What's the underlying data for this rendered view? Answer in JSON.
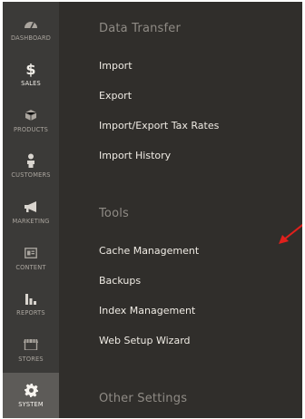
{
  "sidebar": {
    "items": [
      {
        "label": "DASHBOARD",
        "icon": "dashboard-gauge-icon"
      },
      {
        "label": "SALES",
        "icon": "dollar-icon",
        "glyph": "$"
      },
      {
        "label": "PRODUCTS",
        "icon": "cube-icon"
      },
      {
        "label": "CUSTOMERS",
        "icon": "person-icon"
      },
      {
        "label": "MARKETING",
        "icon": "megaphone-icon"
      },
      {
        "label": "CONTENT",
        "icon": "layout-icon"
      },
      {
        "label": "REPORTS",
        "icon": "bar-chart-icon"
      },
      {
        "label": "STORES",
        "icon": "storefront-icon"
      },
      {
        "label": "SYSTEM",
        "icon": "gear-icon"
      }
    ]
  },
  "panel": {
    "data_transfer_title": "Data Transfer",
    "data_transfer_items": [
      "Import",
      "Export",
      "Import/Export Tax Rates",
      "Import History"
    ],
    "tools_title": "Tools",
    "tools_items": [
      "Cache Management",
      "Backups",
      "Index Management",
      "Web Setup Wizard"
    ],
    "other_settings_title": "Other Settings"
  },
  "colors": {
    "panel_bg": "#302e2b",
    "rail_bg": "#3b3a38",
    "active_bg": "#5d5b58",
    "arrow": "#e0201c"
  }
}
